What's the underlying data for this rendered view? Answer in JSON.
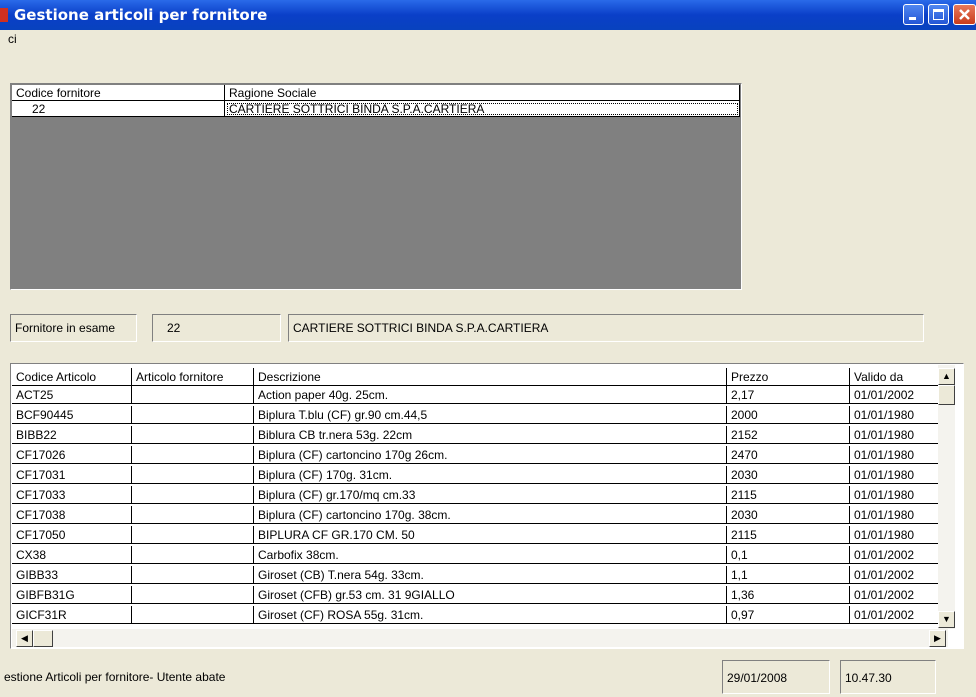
{
  "window": {
    "title": "Gestione articoli per fornitore"
  },
  "menu": {
    "item": "ci"
  },
  "suppliers_grid": {
    "headers": [
      "Codice fornitore",
      "Ragione Sociale"
    ],
    "rows": [
      [
        "22",
        "CARTIERE SOTTRICI BINDA S.P.A.CARTIERA"
      ]
    ]
  },
  "supplier_under_review": {
    "label": "Fornitore in esame",
    "code": "22",
    "name": "CARTIERE SOTTRICI BINDA S.P.A.CARTIERA"
  },
  "articles_grid": {
    "headers": [
      "Codice Articolo",
      "Articolo fornitore",
      "Descrizione",
      "Prezzo",
      "Valido da"
    ],
    "rows": [
      [
        "ACT25",
        "",
        "Action paper 40g. 25cm.",
        "2,17",
        "01/01/2002"
      ],
      [
        "BCF90445",
        "",
        "Biplura T.blu (CF) gr.90 cm.44,5",
        "2000",
        "01/01/1980"
      ],
      [
        "BIBB22",
        "",
        "Biblura CB tr.nera 53g. 22cm",
        "2152",
        "01/01/1980"
      ],
      [
        "CF17026",
        "",
        "Biplura (CF) cartoncino 170g 26cm.",
        "2470",
        "01/01/1980"
      ],
      [
        "CF17031",
        "",
        "Biplura (CF) 170g. 31cm.",
        "2030",
        "01/01/1980"
      ],
      [
        "CF17033",
        "",
        "Biplura (CF) gr.170/mq cm.33",
        "2115",
        "01/01/1980"
      ],
      [
        "CF17038",
        "",
        "Biplura (CF) cartoncino 170g. 38cm.",
        "2030",
        "01/01/1980"
      ],
      [
        "CF17050",
        "",
        "BIPLURA CF GR.170   CM. 50",
        "2115",
        "01/01/1980"
      ],
      [
        "CX38",
        "",
        "Carbofix 38cm.",
        "0,1",
        "01/01/2002"
      ],
      [
        "GIBB33",
        "",
        "Giroset (CB) T.nera 54g. 33cm.",
        "1,1",
        "01/01/2002"
      ],
      [
        "GIBFB31G",
        "",
        "Giroset (CFB) gr.53 cm. 31 9GIALLO",
        "1,36",
        "01/01/2002"
      ],
      [
        "GICF31R",
        "",
        "Giroset (CF) ROSA 55g. 31cm.",
        "0,97",
        "01/01/2002"
      ]
    ]
  },
  "statusbar": {
    "message": "estione Articoli per fornitore- Utente abate",
    "date": "29/01/2008",
    "time": "10.47.30"
  }
}
